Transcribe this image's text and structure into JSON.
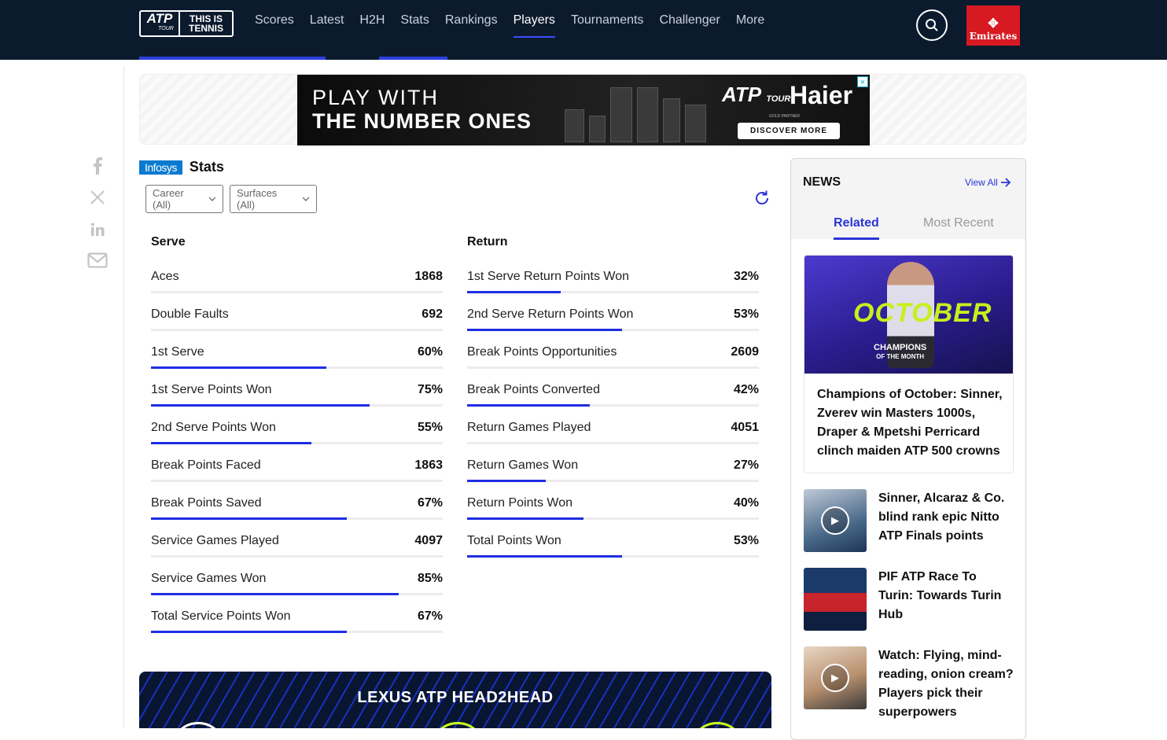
{
  "header": {
    "logo_atp": "ATP",
    "logo_tour": "TOUR",
    "logo_tag1": "THIS IS",
    "logo_tag2": "TENNIS",
    "nav": [
      "Scores",
      "Latest",
      "H2H",
      "Stats",
      "Rankings",
      "Players",
      "Tournaments",
      "Challenger",
      "More"
    ],
    "active_nav": "Players",
    "sponsor": "Emirates"
  },
  "ad": {
    "line1": "PLAY WITH",
    "line2": "THE NUMBER ONES",
    "atp": "ATP",
    "tour": "TOUR",
    "brand": "Haier",
    "gold": "GOLD PARTNER",
    "cta": "DISCOVER MORE",
    "close": "×"
  },
  "share": [
    "facebook-icon",
    "x-icon",
    "linkedin-icon",
    "email-icon"
  ],
  "stats": {
    "sponsor": "Infosys",
    "title": "Stats",
    "filter_career": "Career (All)",
    "filter_surface": "Surfaces (All)",
    "serve_title": "Serve",
    "return_title": "Return",
    "serve": [
      {
        "label": "Aces",
        "value": "1868",
        "bar": null
      },
      {
        "label": "Double Faults",
        "value": "692",
        "bar": null
      },
      {
        "label": "1st Serve",
        "value": "60%",
        "bar": 0.6
      },
      {
        "label": "1st Serve Points Won",
        "value": "75%",
        "bar": 0.75
      },
      {
        "label": "2nd Serve Points Won",
        "value": "55%",
        "bar": 0.55
      },
      {
        "label": "Break Points Faced",
        "value": "1863",
        "bar": null
      },
      {
        "label": "Break Points Saved",
        "value": "67%",
        "bar": 0.67
      },
      {
        "label": "Service Games Played",
        "value": "4097",
        "bar": null
      },
      {
        "label": "Service Games Won",
        "value": "85%",
        "bar": 0.85
      },
      {
        "label": "Total Service Points Won",
        "value": "67%",
        "bar": 0.67
      }
    ],
    "return": [
      {
        "label": "1st Serve Return Points Won",
        "value": "32%",
        "bar": 0.32
      },
      {
        "label": "2nd Serve Return Points Won",
        "value": "53%",
        "bar": 0.53
      },
      {
        "label": "Break Points Opportunities",
        "value": "2609",
        "bar": null
      },
      {
        "label": "Break Points Converted",
        "value": "42%",
        "bar": 0.42
      },
      {
        "label": "Return Games Played",
        "value": "4051",
        "bar": null
      },
      {
        "label": "Return Games Won",
        "value": "27%",
        "bar": 0.27
      },
      {
        "label": "Return Points Won",
        "value": "40%",
        "bar": 0.4
      },
      {
        "label": "Total Points Won",
        "value": "53%",
        "bar": 0.53
      }
    ]
  },
  "h2h": {
    "title": "LEXUS ATP HEAD2HEAD"
  },
  "news": {
    "title": "NEWS",
    "view_all": "View All",
    "tab_related": "Related",
    "tab_recent": "Most Recent",
    "feature": {
      "image_word": "OCTOBER",
      "image_sub1": "CHAMPIONS",
      "image_sub2": "OF THE MONTH",
      "headline": "Champions of October: Sinner, Zverev win Masters 1000s, Draper & Mpetshi Perricard clinch maiden ATP 500 crowns"
    },
    "stories": [
      {
        "headline": "Sinner, Alcaraz & Co. blind rank epic Nitto ATP Finals points",
        "video": true
      },
      {
        "headline": "PIF ATP Race To Turin: Towards Turin Hub",
        "video": false
      },
      {
        "headline": "Watch: Flying, mind-reading, onion cream? Players pick their superpowers",
        "video": true
      }
    ]
  },
  "colors": {
    "nav_bg": "#0c1a2e",
    "accent": "#1f2de3",
    "link": "#2a35d6",
    "emirates": "#d71921",
    "infosys": "#0a7ad0"
  }
}
